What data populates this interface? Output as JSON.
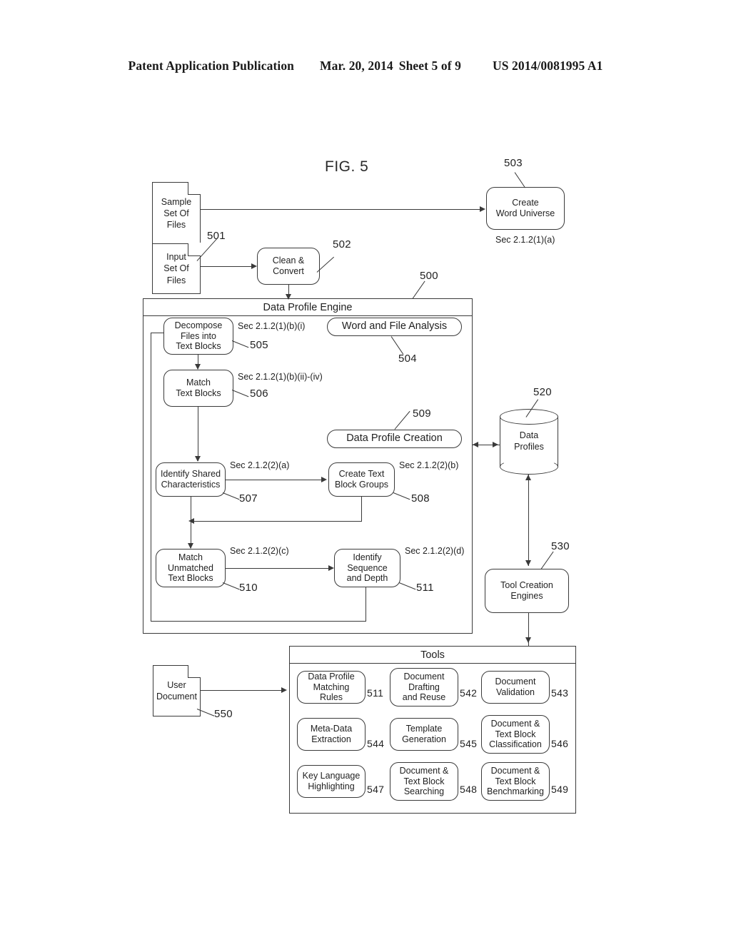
{
  "header": {
    "publication": "Patent Application Publication",
    "date": "Mar. 20, 2014",
    "sheet": "Sheet 5 of 9",
    "patent_number": "US 2014/0081995 A1"
  },
  "figure": {
    "title": "FIG. 5",
    "inputs": {
      "sample_files": "Sample\nSet Of\nFiles",
      "sample_files_line1": "Sample",
      "sample_files_line2": "Set Of",
      "sample_files_line3": "Files",
      "input_files_line1": "Input",
      "input_files_line2": "Set Of",
      "input_files_line3": "Files",
      "input_files_ref": "501",
      "user_document_line1": "User",
      "user_document_line2": "Document",
      "user_document_ref": "550"
    },
    "clean_convert": {
      "line1": "Clean &",
      "line2": "Convert",
      "ref": "502"
    },
    "word_universe": {
      "line1": "Create",
      "line2": "Word Universe",
      "ref": "503",
      "section": "Sec 2.1.2(1)(a)"
    },
    "engine": {
      "title": "Data Profile Engine",
      "ref": "500",
      "phases": [
        {
          "label": "Word and File Analysis",
          "ref": "504"
        },
        {
          "label": "Data Profile Creation",
          "ref": "509"
        }
      ],
      "steps": [
        {
          "line1": "Decompose",
          "line2": "Files into",
          "line3": "Text Blocks",
          "section": "Sec 2.1.2(1)(b)(i)",
          "ref": "505"
        },
        {
          "line1": "Match",
          "line2": "Text Blocks",
          "line3": "",
          "section": "Sec 2.1.2(1)(b)(ii)-(iv)",
          "ref": "506"
        },
        {
          "line1": "Identify Shared",
          "line2": "Characteristics",
          "line3": "",
          "section": "Sec 2.1.2(2)(a)",
          "ref": "507"
        },
        {
          "line1": "Create Text",
          "line2": "Block Groups",
          "line3": "",
          "section": "Sec 2.1.2(2)(b)",
          "ref": "508"
        },
        {
          "line1": "Match",
          "line2": "Unmatched",
          "line3": "Text Blocks",
          "section": "Sec 2.1.2(2)(c)",
          "ref": "510"
        },
        {
          "line1": "Identify",
          "line2": "Sequence",
          "line3": "and Depth",
          "section": "Sec 2.1.2(2)(d)",
          "ref": "511"
        }
      ]
    },
    "data_profiles": {
      "line1": "Data",
      "line2": "Profiles",
      "ref": "520"
    },
    "tool_creation": {
      "line1": "Tool Creation",
      "line2": "Engines",
      "ref": "530"
    },
    "tools": {
      "title": "Tools",
      "items": [
        {
          "line1": "Data Profile",
          "line2": "Matching Rules",
          "line3": "",
          "ref": "511"
        },
        {
          "line1": "Document",
          "line2": "Drafting",
          "line3": "and Reuse",
          "ref": "542"
        },
        {
          "line1": "Document",
          "line2": "Validation",
          "line3": "",
          "ref": "543"
        },
        {
          "line1": "Meta-Data",
          "line2": "Extraction",
          "line3": "",
          "ref": "544"
        },
        {
          "line1": "Template",
          "line2": "Generation",
          "line3": "",
          "ref": "545"
        },
        {
          "line1": "Document &",
          "line2": "Text Block",
          "line3": "Classification",
          "ref": "546"
        },
        {
          "line1": "Key Language",
          "line2": "Highlighting",
          "line3": "",
          "ref": "547"
        },
        {
          "line1": "Document &",
          "line2": "Text Block",
          "line3": "Searching",
          "ref": "548"
        },
        {
          "line1": "Document &",
          "line2": "Text Block",
          "line3": "Benchmarking",
          "ref": "549"
        }
      ]
    }
  }
}
